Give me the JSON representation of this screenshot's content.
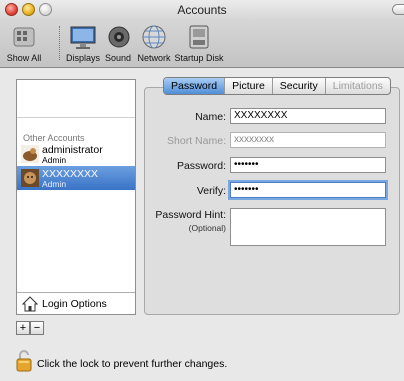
{
  "window": {
    "title": "Accounts"
  },
  "toolbar": {
    "show_all": "Show All",
    "items": [
      {
        "label": "Displays",
        "icon": "displays-icon"
      },
      {
        "label": "Sound",
        "icon": "sound-icon"
      },
      {
        "label": "Network",
        "icon": "network-icon"
      },
      {
        "label": "Startup Disk",
        "icon": "startup-disk-icon"
      }
    ]
  },
  "sidebar": {
    "section_label": "Other Accounts",
    "accounts": [
      {
        "name": "administrator",
        "role": "Admin",
        "selected": false
      },
      {
        "name": "XXXXXXXX",
        "role": "Admin",
        "selected": true
      }
    ],
    "login_options": "Login Options",
    "add_label": "+",
    "remove_label": "−"
  },
  "tabs": [
    {
      "label": "Password",
      "active": true,
      "enabled": true
    },
    {
      "label": "Picture",
      "active": false,
      "enabled": true
    },
    {
      "label": "Security",
      "active": false,
      "enabled": true
    },
    {
      "label": "Limitations",
      "active": false,
      "enabled": false
    }
  ],
  "form": {
    "name_label": "Name:",
    "name_value": "XXXXXXXX",
    "short_name_label": "Short Name:",
    "short_name_value": "xxxxxxxx",
    "password_label": "Password:",
    "password_value": "•••••••",
    "verify_label": "Verify:",
    "verify_value": "•••••••",
    "hint_label": "Password Hint:",
    "hint_optional": "(Optional)",
    "hint_value": ""
  },
  "footer": {
    "lock_text": "Click the lock to prevent further changes."
  },
  "colors": {
    "selection": "#3a73c6",
    "active_tab": "#4f8ed8",
    "focus_ring": "#7ba7e0"
  }
}
